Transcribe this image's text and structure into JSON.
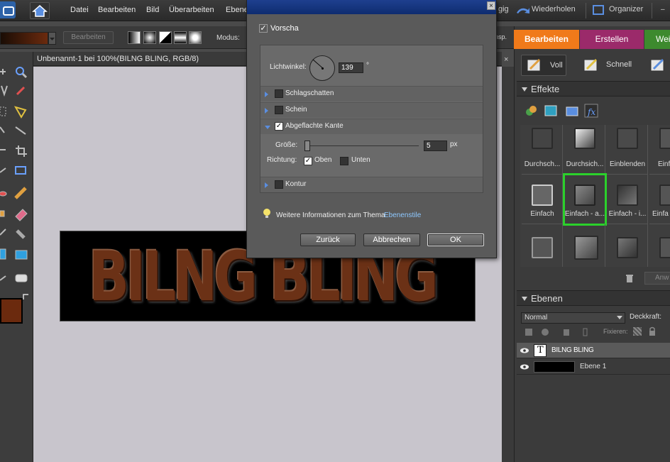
{
  "menubar": {
    "items": [
      "Datei",
      "Bearbeiten",
      "Bild",
      "Überarbeiten",
      "Ebene"
    ],
    "undo_partial": "gig",
    "redo": "Wiederholen",
    "organizer": "Organizer"
  },
  "optionbar": {
    "edit_button": "Bearbeiten",
    "mode_label": "Modus:",
    "insp_partial": "nsp."
  },
  "document": {
    "title": "Unbenannt-1 bei 100%(BILNG BLING, RGB/8)",
    "art_text": "BILNG BLING"
  },
  "tabs": {
    "edit": "Bearbeiten",
    "create": "Erstellen",
    "share_partial": "Wei"
  },
  "fx_modes": {
    "full": "Voll",
    "quick": "Schnell"
  },
  "effects": {
    "header": "Effekte",
    "row1": [
      "Durchsch...",
      "Durchsich...",
      "Einblenden",
      "Einf"
    ],
    "row2": [
      "Einfach",
      "Einfach - a...",
      "Einfach - i...",
      "Einfa"
    ],
    "apply_partial": "Anw"
  },
  "layers": {
    "header": "Ebenen",
    "blend_mode": "Normal",
    "opacity_label": "Deckkraft:",
    "lock_label": "Fixieren:",
    "rows": [
      {
        "name": "BILNG BLING",
        "type": "text"
      },
      {
        "name": "Ebene 1",
        "type": "raster"
      }
    ]
  },
  "dialog": {
    "preview_label": "Vorscha",
    "light_angle_label": "Lichtwinkel:",
    "light_angle_value": "139",
    "degree_symbol": "°",
    "sections": {
      "drop_shadow": "Schlagschatten",
      "glow": "Schein",
      "bevel": "Abgeflachte Kante",
      "stroke": "Kontur"
    },
    "size_label": "Größe:",
    "size_value": "5",
    "size_unit": "px",
    "direction_label": "Richtung:",
    "dir_up": "Oben",
    "dir_down": "Unten",
    "info_text": "Weitere Informationen zum Thema",
    "info_link": "Ebenenstile",
    "btn_reset": "Zurück",
    "btn_cancel": "Abbrechen",
    "btn_ok": "OK"
  },
  "colors": {
    "accent_orange": "#f07a1a",
    "tab_create": "#9b2a6a",
    "tab_share": "#3d8a2e",
    "foreground": "#6b2a0e",
    "selection_green": "#2bd12b"
  }
}
